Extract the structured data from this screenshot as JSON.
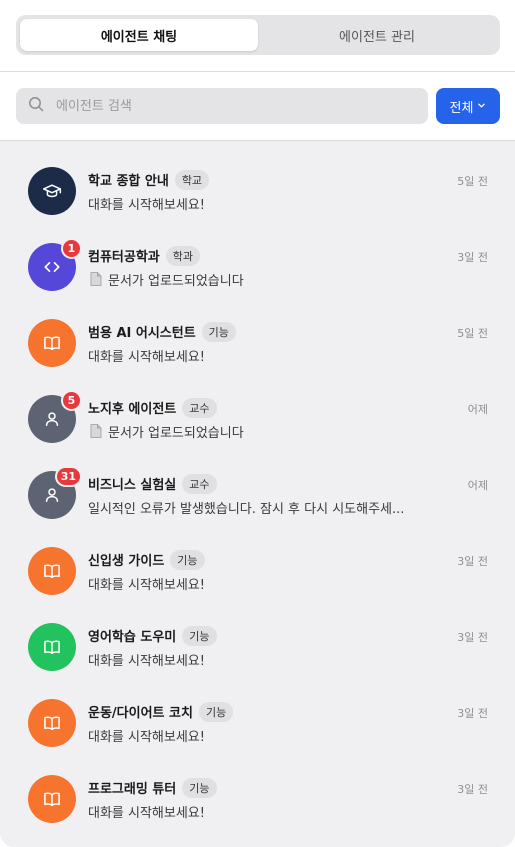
{
  "tabs": [
    {
      "label": "에이전트 채팅",
      "active": true
    },
    {
      "label": "에이전트 관리",
      "active": false
    }
  ],
  "search": {
    "placeholder": "에이전트 검색",
    "value": ""
  },
  "filter": {
    "label": "전체"
  },
  "colors": {
    "accent": "#2563eb",
    "badge": "#e5393e",
    "navy": "#1b2b48",
    "purple": "#5548d9",
    "orange": "#f7742f",
    "gray": "#5d6372",
    "green": "#22c25e"
  },
  "chats": [
    {
      "name": "학교 종합 안내",
      "tag": "학교",
      "time": "5일 전",
      "preview": "대화를 시작해보세요!",
      "badge": "",
      "icon": "graduation-cap-icon",
      "color": "navy",
      "attachment": false
    },
    {
      "name": "컴퓨터공학과",
      "tag": "학과",
      "time": "3일 전",
      "preview": "문서가 업로드되었습니다",
      "badge": "1",
      "icon": "code-icon",
      "color": "purple",
      "attachment": true
    },
    {
      "name": "범용 AI 어시스턴트",
      "tag": "기능",
      "time": "5일 전",
      "preview": "대화를 시작해보세요!",
      "badge": "",
      "icon": "book-icon",
      "color": "orange",
      "attachment": false
    },
    {
      "name": "노지후 에이전트",
      "tag": "교수",
      "time": "어제",
      "preview": "문서가 업로드되었습니다",
      "badge": "5",
      "icon": "user-icon",
      "color": "gray",
      "attachment": true
    },
    {
      "name": "비즈니스 실험실",
      "tag": "교수",
      "time": "어제",
      "preview": "일시적인 오류가 발생했습니다. 잠시 후 다시 시도해주세...",
      "badge": "31",
      "icon": "user-icon",
      "color": "gray",
      "attachment": false
    },
    {
      "name": "신입생 가이드",
      "tag": "기능",
      "time": "3일 전",
      "preview": "대화를 시작해보세요!",
      "badge": "",
      "icon": "book-icon",
      "color": "orange",
      "attachment": false
    },
    {
      "name": "영어학습 도우미",
      "tag": "기능",
      "time": "3일 전",
      "preview": "대화를 시작해보세요!",
      "badge": "",
      "icon": "book-icon",
      "color": "green",
      "attachment": false
    },
    {
      "name": "운동/다이어트 코치",
      "tag": "기능",
      "time": "3일 전",
      "preview": "대화를 시작해보세요!",
      "badge": "",
      "icon": "book-icon",
      "color": "orange",
      "attachment": false
    },
    {
      "name": "프로그래밍 튜터",
      "tag": "기능",
      "time": "3일 전",
      "preview": "대화를 시작해보세요!",
      "badge": "",
      "icon": "book-icon",
      "color": "orange",
      "attachment": false
    }
  ]
}
